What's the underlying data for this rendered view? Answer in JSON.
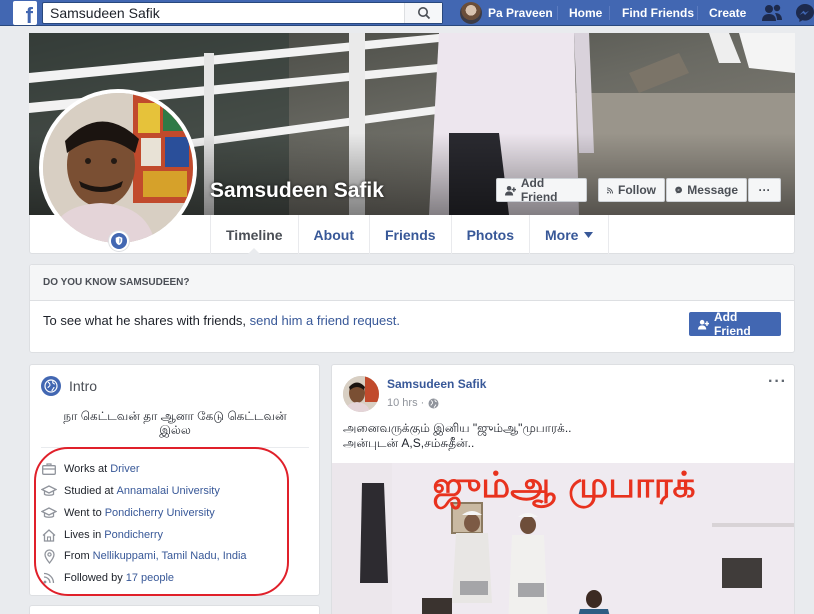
{
  "topbar": {
    "search_value": "Samsudeen Safik",
    "user_name": "Pa Praveen",
    "nav": [
      "Home",
      "Find Friends",
      "Create"
    ]
  },
  "profile": {
    "name": "Samsudeen Safik",
    "buttons": {
      "add_friend": "Add Friend",
      "follow": "Follow",
      "message": "Message",
      "more": "···"
    },
    "tabs": [
      "Timeline",
      "About",
      "Friends",
      "Photos",
      "More"
    ]
  },
  "know": {
    "heading": "DO YOU KNOW SAMSUDEEN?",
    "text": "To see what he shares with friends, ",
    "link": "send him a friend request.",
    "button": "Add Friend"
  },
  "intro": {
    "title": "Intro",
    "bio": "நா கெட்டவன் தா ஆனா கேடு கெட்டவன் இல்ல",
    "rows": [
      {
        "icon": "briefcase-icon",
        "prefix": "Works at",
        "link": "Driver"
      },
      {
        "icon": "graduation-cap-icon",
        "prefix": "Studied at",
        "link": "Annamalai University"
      },
      {
        "icon": "graduation-cap-icon",
        "prefix": "Went to",
        "link": "Pondicherry University"
      },
      {
        "icon": "home-icon",
        "prefix": "Lives in",
        "link": "Pondicherry"
      },
      {
        "icon": "location-pin-icon",
        "prefix": "From",
        "link": "Nellikuppami, Tamil Nadu, India"
      },
      {
        "icon": "rss-icon",
        "prefix": "Followed by",
        "link": "17 people"
      }
    ]
  },
  "post": {
    "author": "Samsudeen Safik",
    "time": "10 hrs ·",
    "more": "···",
    "text_line1": "அனைவருக்கும் இனிய \"ஜும்ஆ\"முபாரக்..",
    "text_line2": "அன்புடன் A,S,சம்சுதீன்..",
    "image_title": "ஜும்ஆ முபாரக்"
  },
  "colors": {
    "facebook_blue": "#4267b2",
    "link_blue": "#385898",
    "annotation_red": "#e0202a",
    "image_title_red": "#e8321e"
  }
}
